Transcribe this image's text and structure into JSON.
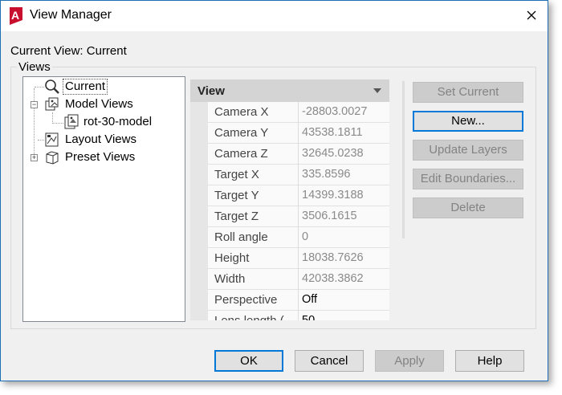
{
  "window": {
    "title": "View Manager",
    "app_icon": "autocad-icon",
    "close_icon": "close-icon"
  },
  "current_view": {
    "label": "Current View:",
    "value": "Current"
  },
  "views_group": {
    "label": "Views"
  },
  "tree": {
    "items": [
      {
        "label": "Current",
        "icon": "magnifier-icon",
        "selected": true
      },
      {
        "label": "Model Views",
        "icon": "model-views-icon",
        "expander": "−"
      },
      {
        "label": "rot-30-model",
        "icon": "camera-view-icon"
      },
      {
        "label": "Layout Views",
        "icon": "layout-icon"
      },
      {
        "label": "Preset Views",
        "icon": "cube-icon",
        "expander": "+"
      }
    ]
  },
  "properties": {
    "header": "View",
    "rows": [
      {
        "key": "Camera X",
        "value": "-28803.0027",
        "dim": true
      },
      {
        "key": "Camera Y",
        "value": "43538.1811",
        "dim": true
      },
      {
        "key": "Camera Z",
        "value": "32645.0238",
        "dim": true
      },
      {
        "key": "Target X",
        "value": "335.8596",
        "dim": true
      },
      {
        "key": "Target Y",
        "value": "14399.3188",
        "dim": true
      },
      {
        "key": "Target Z",
        "value": "3506.1615",
        "dim": true
      },
      {
        "key": "Roll angle",
        "value": "0",
        "dim": true
      },
      {
        "key": "Height",
        "value": "18038.7626",
        "dim": true
      },
      {
        "key": "Width",
        "value": "42038.3862",
        "dim": true
      },
      {
        "key": "Perspective",
        "value": "Off",
        "dim": false
      },
      {
        "key": "Lens length (",
        "value": "50",
        "dim": false
      }
    ]
  },
  "side_buttons": {
    "set_current": "Set Current",
    "new": "New...",
    "update_layers": "Update Layers",
    "edit_boundaries": "Edit Boundaries...",
    "delete": "Delete"
  },
  "footer_buttons": {
    "ok": "OK",
    "cancel": "Cancel",
    "apply": "Apply",
    "help": "Help"
  },
  "colors": {
    "accent": "#0078d7",
    "app_red": "#c8102e"
  }
}
